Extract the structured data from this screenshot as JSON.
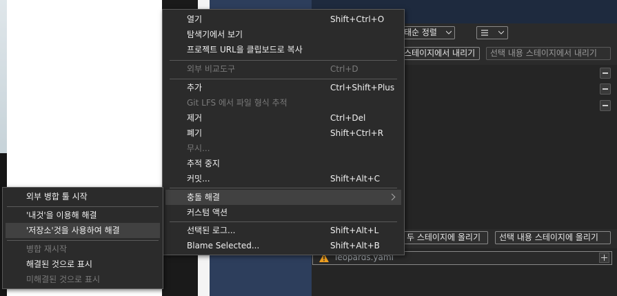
{
  "toolbar": {
    "sort_label": "태순 정렬",
    "list_icon": "list-icon",
    "unstage_all_label": "스테이지에서 내리기",
    "unstage_selected_label": "선택 내용 스테이지에서 내리기",
    "stage_all_label": "두 스테이지에 올리기",
    "stage_selected_label": "선택 내용 스테이지에 올리기"
  },
  "file": {
    "name": "leopards.yaml",
    "status_icon": "warning-icon"
  },
  "context_menu": {
    "items": [
      {
        "label": "열기",
        "shortcut": "Shift+Ctrl+O"
      },
      {
        "label": "탐색기에서 보기",
        "shortcut": ""
      },
      {
        "label": "프로젝트 URL을 클립보드로 복사",
        "shortcut": ""
      },
      {
        "label": "외부 비교도구",
        "shortcut": "Ctrl+D"
      },
      {
        "label": "추가",
        "shortcut": "Ctrl+Shift+Plus"
      },
      {
        "label": "Git LFS 에서 파일 형식 추적",
        "shortcut": ""
      },
      {
        "label": "제거",
        "shortcut": "Ctrl+Del"
      },
      {
        "label": "폐기",
        "shortcut": "Shift+Ctrl+R"
      },
      {
        "label": "무시...",
        "shortcut": ""
      },
      {
        "label": "추적 중지",
        "shortcut": ""
      },
      {
        "label": "커밋...",
        "shortcut": "Shift+Alt+C"
      },
      {
        "label": "충돌 해결",
        "shortcut": ""
      },
      {
        "label": "커스텀 액션",
        "shortcut": ""
      },
      {
        "label": "선택된 로그...",
        "shortcut": "Shift+Alt+L"
      },
      {
        "label": "Blame Selected...",
        "shortcut": "Shift+Alt+B"
      }
    ]
  },
  "conflict_submenu": {
    "items": [
      {
        "label": "외부 병합 툴 시작"
      },
      {
        "label": "'내것'을 이용해 해결"
      },
      {
        "label": "'저장소'것을 사용하여 해결"
      },
      {
        "label": "병합 재시작"
      },
      {
        "label": "해결된 것으로 표시"
      },
      {
        "label": "미해결된 것으로 표시"
      }
    ]
  },
  "colors": {
    "menu_bg": "#2b2b2b",
    "highlight": "#414141",
    "warning": "#f0a020",
    "navy": "#2d3e5c"
  }
}
